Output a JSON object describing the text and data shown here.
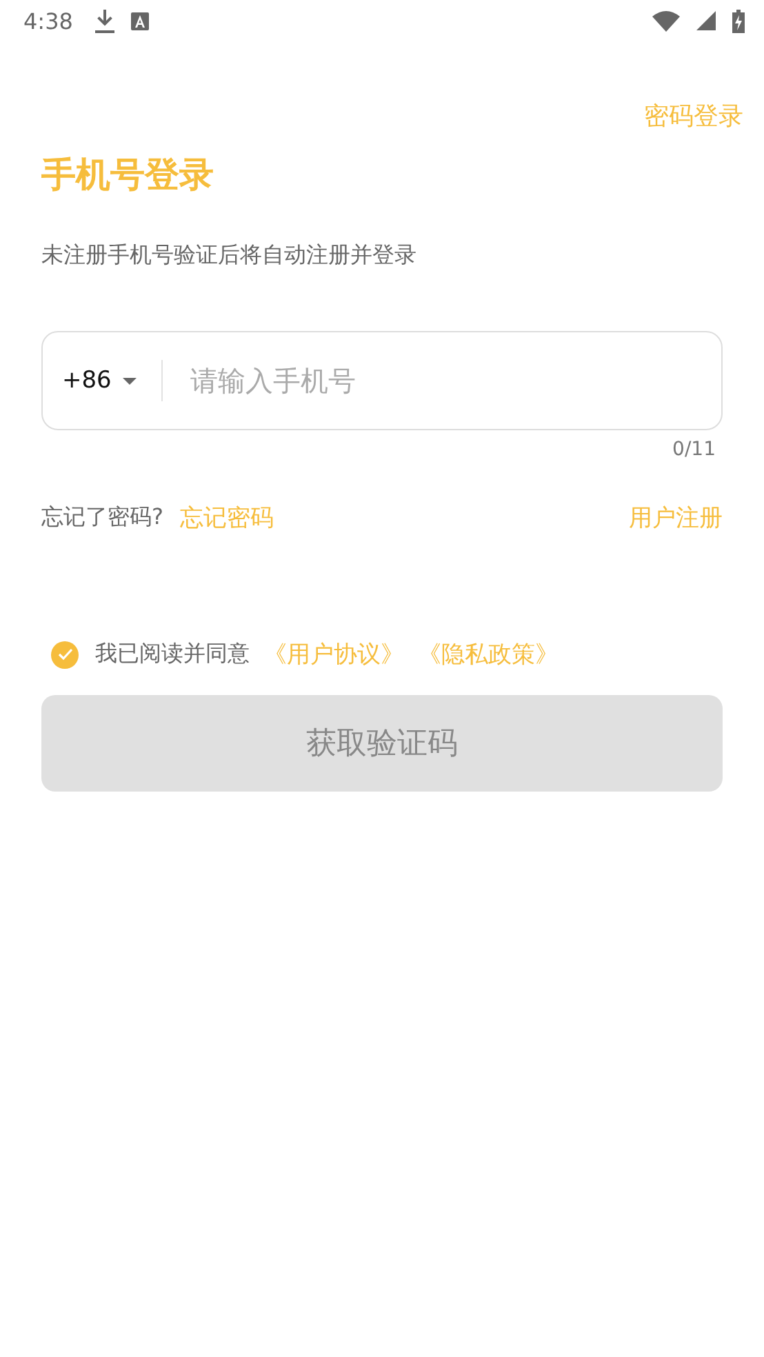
{
  "status_bar": {
    "time": "4:38"
  },
  "top_link": "密码登录",
  "title": "手机号登录",
  "subtitle": "未注册手机号验证后将自动注册并登录",
  "phone_field": {
    "country_code": "+86",
    "placeholder": "请输入手机号",
    "counter": "0/11"
  },
  "forgot": {
    "prompt": "忘记了密码?",
    "link": "忘记密码"
  },
  "register_link": "用户注册",
  "agreement": {
    "checked": true,
    "text": "我已阅读并同意",
    "links": [
      "《用户协议》",
      "《隐私政策》"
    ]
  },
  "submit": {
    "label": "获取验证码",
    "disabled": true
  }
}
